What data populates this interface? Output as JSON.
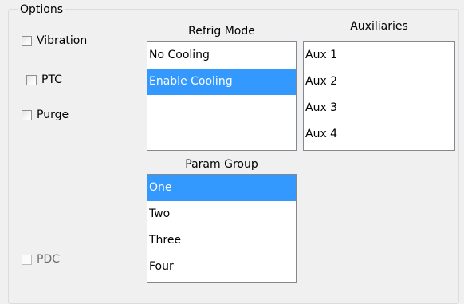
{
  "group": {
    "title": "Options"
  },
  "checkboxes": {
    "vibration": {
      "label": "Vibration",
      "checked": false
    },
    "ptc": {
      "label": "PTC",
      "checked": false
    },
    "purge": {
      "label": "Purge",
      "checked": false
    },
    "pdc": {
      "label": "PDC",
      "checked": false,
      "enabled": false
    }
  },
  "refrig_mode": {
    "label": "Refrig Mode",
    "items": [
      "No Cooling",
      "Enable Cooling"
    ],
    "selected": "Enable Cooling"
  },
  "auxiliaries": {
    "label": "Auxiliaries",
    "items": [
      "Aux 1",
      "Aux 2",
      "Aux 3",
      "Aux 4"
    ]
  },
  "param_group": {
    "label": "Param Group",
    "items": [
      "One",
      "Two",
      "Three",
      "Four"
    ],
    "selected": "One"
  },
  "colors": {
    "selection": "#3399ff",
    "background": "#f0f0f0",
    "list_border": "#828790"
  }
}
